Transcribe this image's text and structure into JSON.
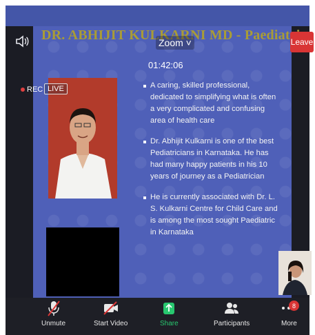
{
  "meeting": {
    "slide_title": "DR. ABHIJIT KULKARNI MD - Paediatric",
    "zoom_menu": "Zoom ˅",
    "timer": "01:42:06",
    "leave_label": "Leave",
    "rec_label": "REC",
    "live_label": "LIVE"
  },
  "slide": {
    "bullets": [
      "A caring, skilled professional, dedicated to simplifying what is often a very complicated and confusing area of health care",
      "Dr. Abhijit Kulkarni is one of the best Pediatricians in Karnataka. He has had many happy patients in his 10 years of journey as a Pediatrician",
      "He is currently associated with Dr. L. S. Kulkarni Centre for Child Care and is among the most sought Paediatric in Karnataka"
    ]
  },
  "toolbar": {
    "unmute": "Unmute",
    "start_video": "Start Video",
    "share": "Share",
    "participants": "Participants",
    "more": "More",
    "more_badge": "8"
  },
  "colors": {
    "accent_green": "#28c76f",
    "leave_red": "#d93535",
    "slide_blue": "#4f60b8",
    "title_gold": "#a99c36"
  },
  "icons": [
    "speaker-icon",
    "mic-muted-icon",
    "video-off-icon",
    "share-arrow-icon",
    "participants-icon",
    "more-dots-icon"
  ]
}
